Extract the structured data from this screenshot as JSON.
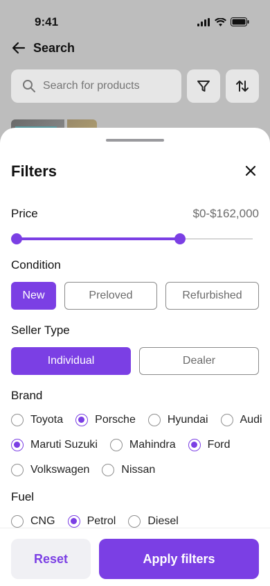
{
  "status": {
    "time": "9:41"
  },
  "header": {
    "title": "Search"
  },
  "search": {
    "placeholder": "Search for products"
  },
  "sheet": {
    "title": "Filters",
    "price": {
      "label": "Price",
      "value_text": "$0-$162,000",
      "range_fraction": [
        0,
        0.71
      ]
    },
    "condition": {
      "label": "Condition",
      "options": [
        "New",
        "Preloved",
        "Refurbished"
      ],
      "selected": "New"
    },
    "seller_type": {
      "label": "Seller Type",
      "options": [
        "Individual",
        "Dealer"
      ],
      "selected": "Individual"
    },
    "brand": {
      "label": "Brand",
      "rows": [
        [
          {
            "name": "Toyota",
            "checked": false
          },
          {
            "name": "Porsche",
            "checked": true
          },
          {
            "name": "Hyundai",
            "checked": false
          },
          {
            "name": "Audi",
            "checked": false
          }
        ],
        [
          {
            "name": "Maruti Suzuki",
            "checked": true
          },
          {
            "name": "Mahindra",
            "checked": false
          },
          {
            "name": "Ford",
            "checked": true
          }
        ],
        [
          {
            "name": "Volkswagen",
            "checked": false
          },
          {
            "name": "Nissan",
            "checked": false
          }
        ]
      ]
    },
    "fuel": {
      "label": "Fuel",
      "options": [
        {
          "name": "CNG",
          "checked": false
        },
        {
          "name": "Petrol",
          "checked": true
        },
        {
          "name": "Diesel",
          "checked": false
        }
      ]
    }
  },
  "footer": {
    "reset_label": "Reset",
    "apply_label": "Apply filters"
  },
  "colors": {
    "accent": "#7b3fe4",
    "overlay": "#bdbdbd"
  }
}
